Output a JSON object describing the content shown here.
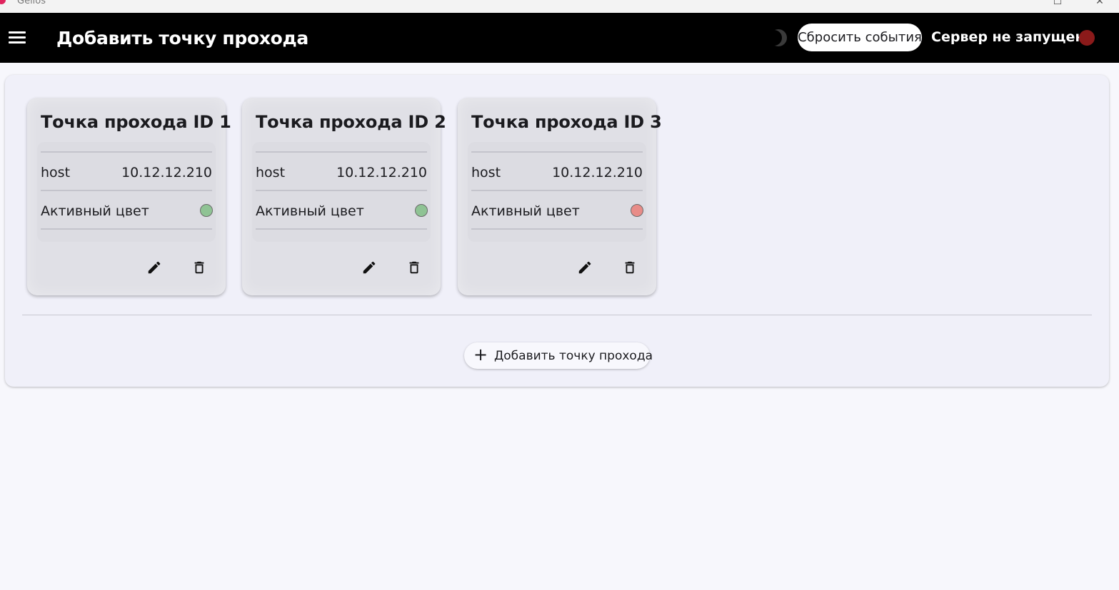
{
  "window": {
    "title": "Gellos",
    "maximize_glyph": "☐",
    "close_glyph": "✕"
  },
  "appbar": {
    "title": "Добавить точку прохода",
    "reset_label": "Сбросить события",
    "server_status": "Сервер не запущен",
    "server_status_color": "#8b1a1a",
    "theme_icon": "moon-icon"
  },
  "checkpoints": [
    {
      "title": "Точка прохода ID 1",
      "host_label": "host",
      "host_value": "10.12.12.210",
      "color_label": "Активный цвет",
      "color": "#8fc394"
    },
    {
      "title": "Точка прохода ID 2",
      "host_label": "host",
      "host_value": "10.12.12.210",
      "color_label": "Активный цвет",
      "color": "#8fc394"
    },
    {
      "title": "Точка прохода ID 3",
      "host_label": "host",
      "host_value": "10.12.12.210",
      "color_label": "Активный цвет",
      "color": "#e88c88"
    }
  ],
  "add_button": {
    "label": "Добавить точку прохода",
    "icon": "+"
  }
}
